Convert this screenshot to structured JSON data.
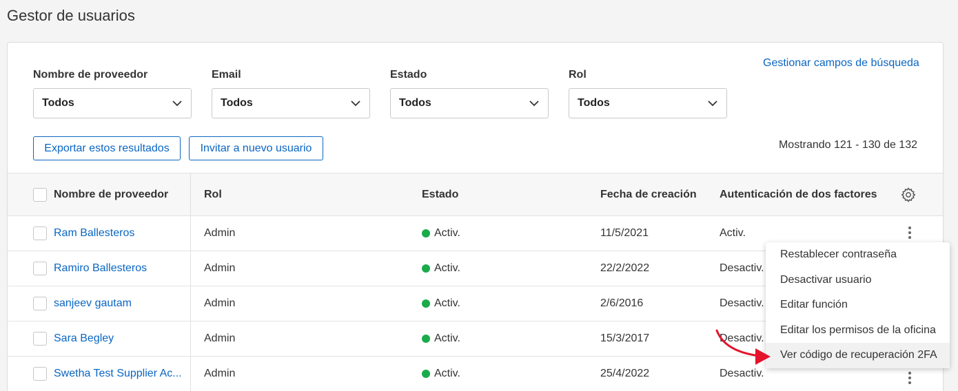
{
  "page": {
    "title": "Gestor de usuarios"
  },
  "manage_search_fields": "Gestionar campos de búsqueda",
  "filters": [
    {
      "label": "Nombre de proveedor",
      "value": "Todos"
    },
    {
      "label": "Email",
      "value": "Todos"
    },
    {
      "label": "Estado",
      "value": "Todos"
    },
    {
      "label": "Rol",
      "value": "Todos"
    }
  ],
  "actions": {
    "export": "Exportar estos resultados",
    "invite": "Invitar a nuevo usuario"
  },
  "pagination": {
    "showing": "Mostrando 121 - 130 de 132"
  },
  "table": {
    "headers": {
      "name": "Nombre de proveedor",
      "role": "Rol",
      "status": "Estado",
      "created": "Fecha de creación",
      "twofa": "Autenticación de dos factores"
    },
    "rows": [
      {
        "name": "Ram Ballesteros",
        "role": "Admin",
        "status": "Activ.",
        "created": "11/5/2021",
        "twofa": "Activ."
      },
      {
        "name": "Ramiro Ballesteros",
        "role": "Admin",
        "status": "Activ.",
        "created": "22/2/2022",
        "twofa": "Desactiv."
      },
      {
        "name": "sanjeev gautam",
        "role": "Admin",
        "status": "Activ.",
        "created": "2/6/2016",
        "twofa": "Desactiv."
      },
      {
        "name": "Sara Begley",
        "role": "Admin",
        "status": "Activ.",
        "created": "15/3/2017",
        "twofa": "Desactiv."
      },
      {
        "name": "Swetha Test Supplier Ac...",
        "role": "Admin",
        "status": "Activ.",
        "created": "25/4/2022",
        "twofa": "Desactiv."
      }
    ]
  },
  "context_menu": {
    "items": [
      "Restablecer contraseña",
      "Desactivar usuario",
      "Editar función",
      "Editar los permisos de la oficina",
      "Ver código de recuperación 2FA"
    ]
  },
  "colors": {
    "link": "#0a66c2",
    "active_dot": "#1aab4b",
    "annotation_arrow": "#e3142b"
  },
  "icons": {
    "settings": "gear-icon",
    "dropdown": "chevron-down-icon",
    "row_menu": "kebab-menu-icon"
  }
}
